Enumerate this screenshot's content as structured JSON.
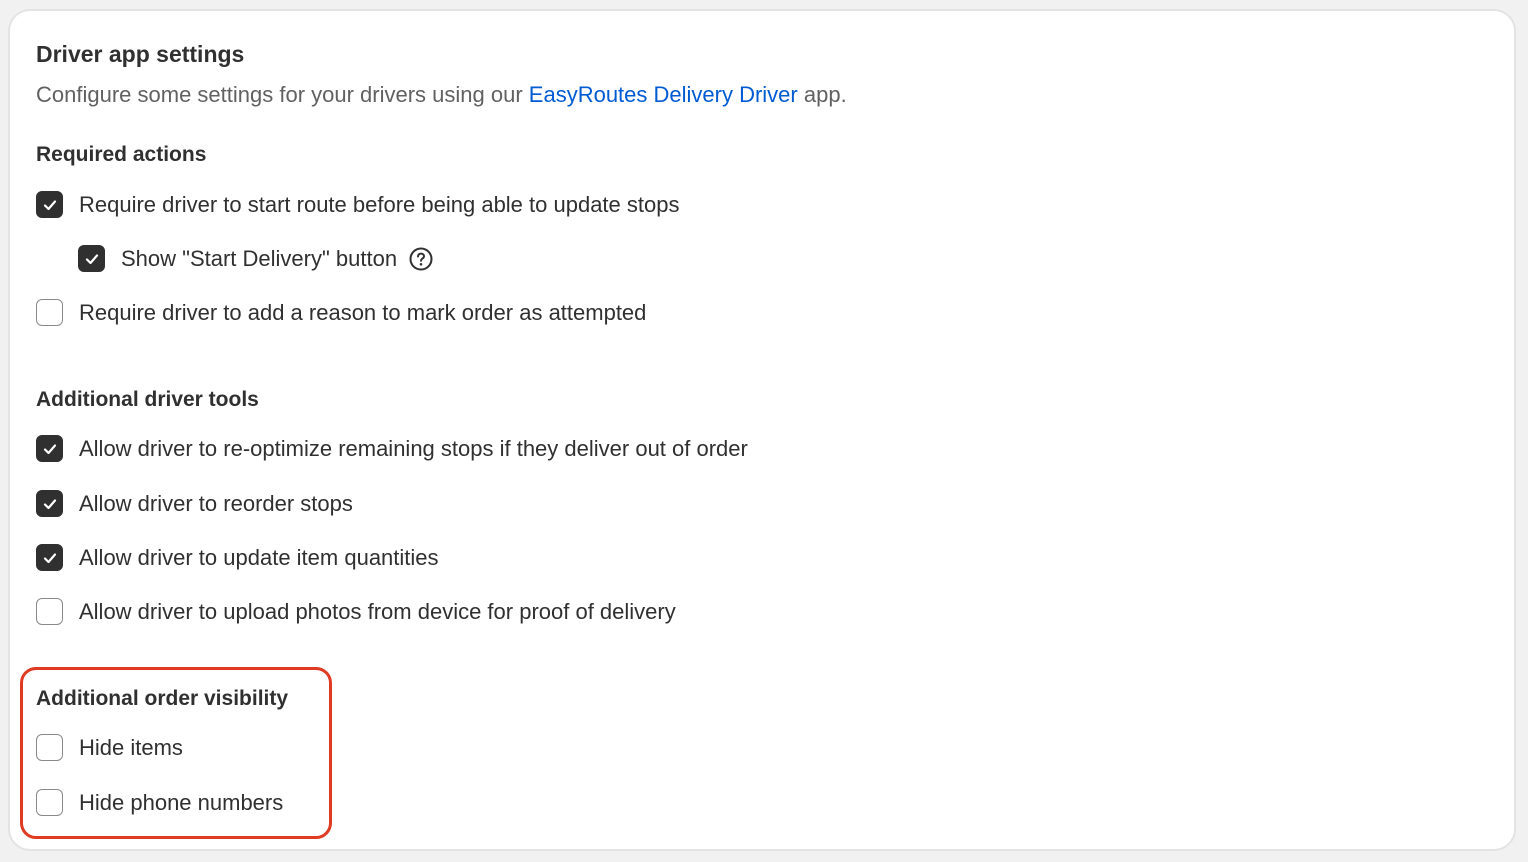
{
  "card": {
    "title": "Driver app settings",
    "subtitle_prefix": "Configure some settings for your drivers using our ",
    "subtitle_link": "EasyRoutes Delivery Driver",
    "subtitle_suffix": " app."
  },
  "sections": {
    "required_actions": {
      "heading": "Required actions",
      "items": [
        {
          "label": "Require driver to start route before being able to update stops",
          "checked": true
        },
        {
          "label": "Show \"Start Delivery\" button",
          "checked": true,
          "icon": "help-circle-icon"
        },
        {
          "label": "Require driver to add a reason to mark order as attempted",
          "checked": false
        }
      ]
    },
    "driver_tools": {
      "heading": "Additional driver tools",
      "items": [
        {
          "label": "Allow driver to re-optimize remaining stops if they deliver out of order",
          "checked": true
        },
        {
          "label": "Allow driver to reorder stops",
          "checked": true
        },
        {
          "label": "Allow driver to update item quantities",
          "checked": true
        },
        {
          "label": "Allow driver to upload photos from device for proof of delivery",
          "checked": false
        }
      ]
    },
    "order_visibility": {
      "heading": "Additional order visibility",
      "items": [
        {
          "label": "Hide items",
          "checked": false
        },
        {
          "label": "Hide phone numbers",
          "checked": false
        }
      ]
    }
  },
  "colors": {
    "link": "#005bd3",
    "checkbox_checked": "#303030",
    "highlight_outline": "#e03a22"
  }
}
